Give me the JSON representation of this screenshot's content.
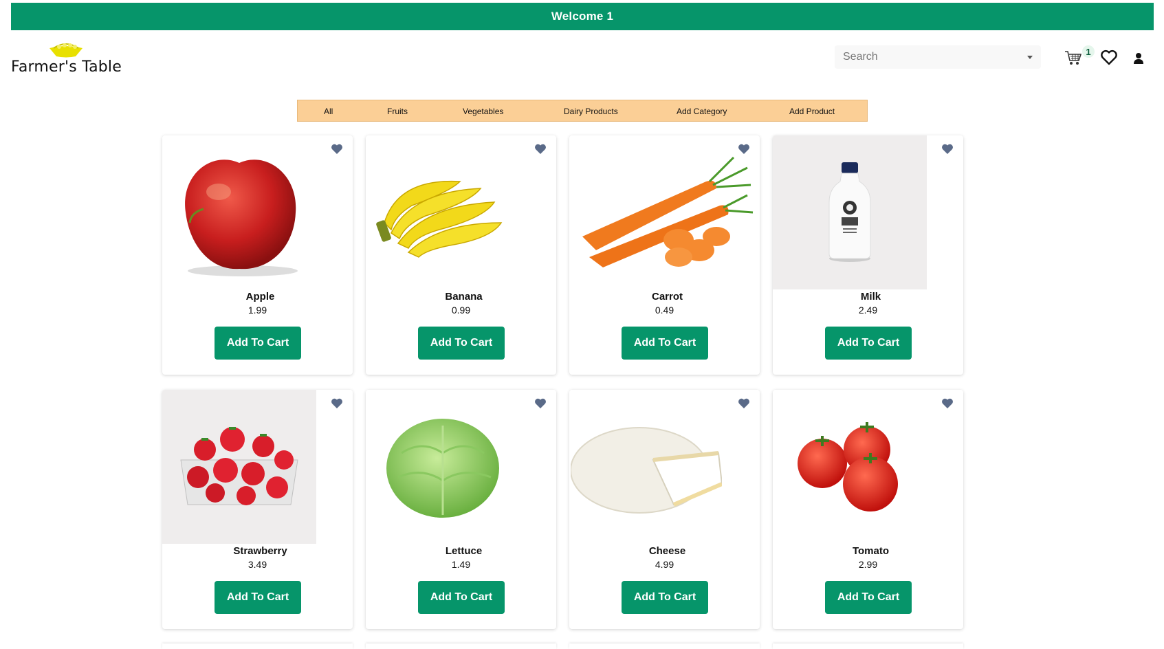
{
  "header": {
    "welcome": "Welcome 1",
    "logo_text": "Farmer's Table",
    "search_placeholder": "Search",
    "cart_count": "1"
  },
  "categories": [
    {
      "label": "All"
    },
    {
      "label": "Fruits"
    },
    {
      "label": "Vegetables"
    },
    {
      "label": "Dairy Products"
    },
    {
      "label": "Add Category"
    },
    {
      "label": "Add Product"
    }
  ],
  "add_to_cart_label": "Add To Cart",
  "products": [
    {
      "name": "Apple",
      "price": "1.99",
      "icon": "apple-image"
    },
    {
      "name": "Banana",
      "price": "0.99",
      "icon": "banana-image"
    },
    {
      "name": "Carrot",
      "price": "0.49",
      "icon": "carrot-image"
    },
    {
      "name": "Milk",
      "price": "2.49",
      "icon": "milk-bottle-image"
    },
    {
      "name": "Strawberry",
      "price": "3.49",
      "icon": "strawberry-image"
    },
    {
      "name": "Lettuce",
      "price": "1.49",
      "icon": "lettuce-image"
    },
    {
      "name": "Cheese",
      "price": "4.99",
      "icon": "cheese-image"
    },
    {
      "name": "Tomato",
      "price": "2.99",
      "icon": "tomato-image"
    }
  ],
  "colors": {
    "primary": "#06956a",
    "category_bar": "#fbcf96",
    "heart": "#5a6a88"
  }
}
